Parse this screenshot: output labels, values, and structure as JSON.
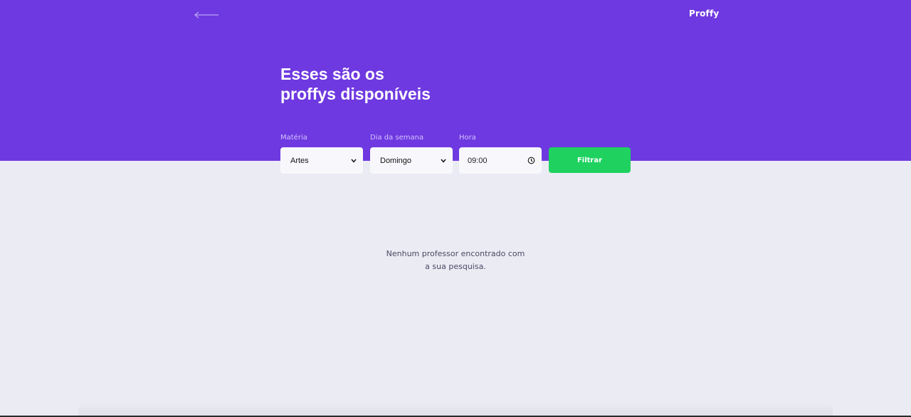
{
  "header": {
    "back_icon": "arrow-left-icon",
    "logo": "Proffy",
    "title_line1": "Esses são os",
    "title_line2": "proffys disponíveis"
  },
  "filters": {
    "subject": {
      "label": "Matéria",
      "value": "Artes"
    },
    "weekday": {
      "label": "Dia da semana",
      "value": "Domingo"
    },
    "time": {
      "label": "Hora",
      "value": "09:00"
    },
    "submit_label": "Filtrar"
  },
  "results": {
    "empty_line1": "Nenhum professor encontrado com",
    "empty_line2": "a sua pesquisa."
  },
  "colors": {
    "header_bg": "#6e39e0",
    "page_bg": "#ebebf4",
    "button_bg": "#1fd260",
    "label": "#d4c2ff"
  }
}
